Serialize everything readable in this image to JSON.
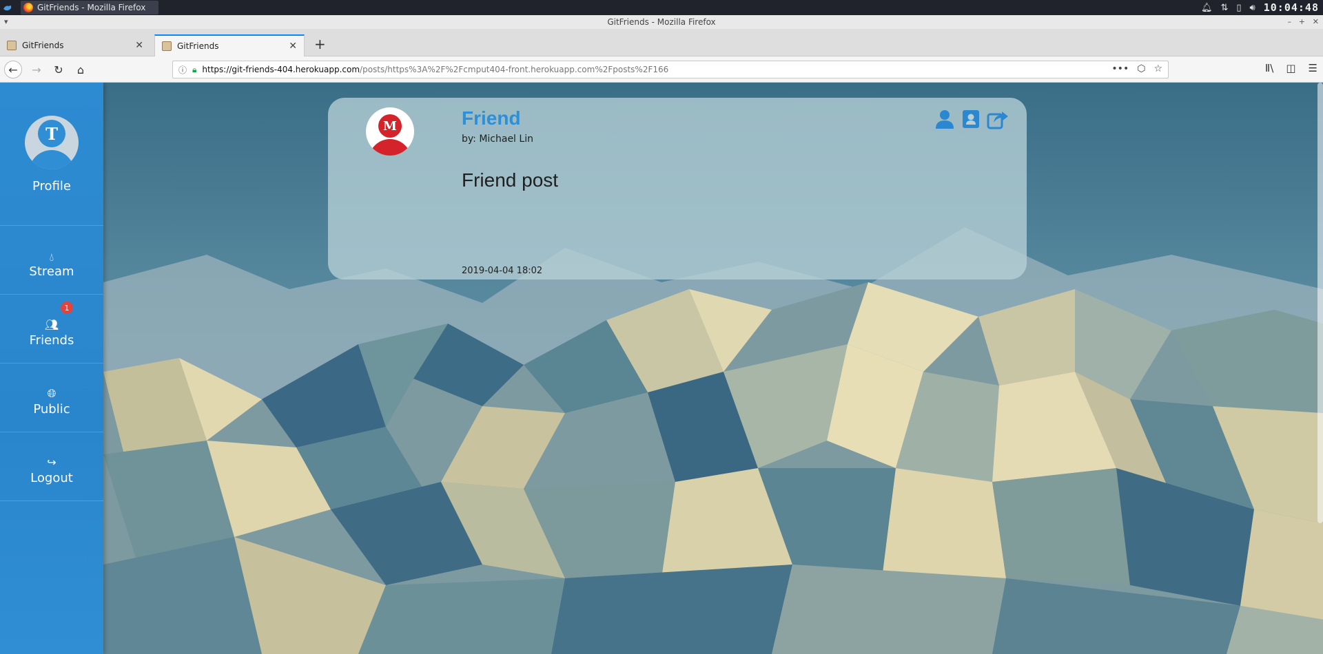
{
  "os": {
    "taskbar_title": "GitFriends - Mozilla Firefox",
    "clock": "10:04:48"
  },
  "window": {
    "title": "GitFriends - Mozilla Firefox"
  },
  "tabs": [
    {
      "label": "GitFriends"
    },
    {
      "label": "GitFriends"
    }
  ],
  "address_bar": {
    "url_host": "https://git-friends-404.herokuapp.com",
    "url_path": "/posts/https%3A%2F%2Fcmput404-front.herokuapp.com%2Fposts%2F166"
  },
  "sidebar": {
    "profile": {
      "label": "Profile",
      "avatar_letter": "T"
    },
    "items": [
      {
        "label": "Stream",
        "icon": "tint-icon"
      },
      {
        "label": "Friends",
        "icon": "users-icon",
        "badge": "1"
      },
      {
        "label": "Public",
        "icon": "globe-icon"
      },
      {
        "label": "Logout",
        "icon": "sign-out-icon"
      }
    ]
  },
  "post": {
    "title": "Friend",
    "author": "by: Michael Lin",
    "avatar_letter": "M",
    "content": "Friend post",
    "date": "2019-04-04 18:02",
    "actions": [
      "user-icon",
      "contact-card-icon",
      "share-icon"
    ]
  },
  "colors": {
    "sidebar": "#2d8bd2",
    "title_blue": "#2d8fd8",
    "badge_red": "#e0443e",
    "avatar_red": "#d4232a"
  }
}
